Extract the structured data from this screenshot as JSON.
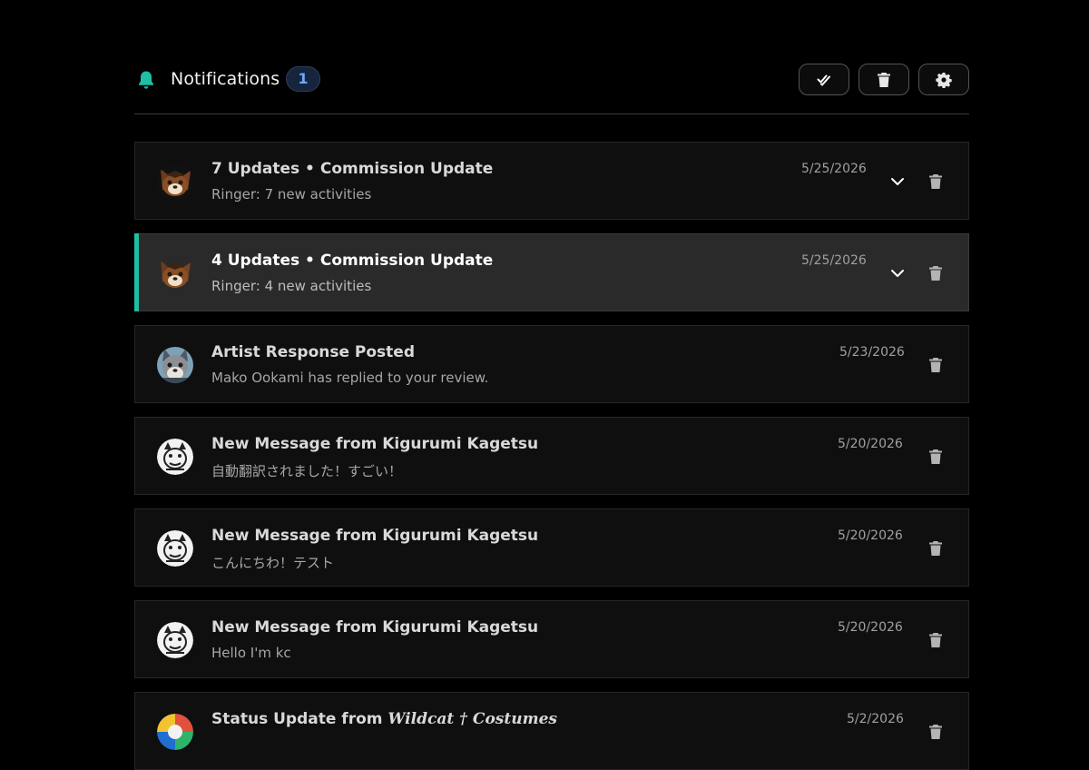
{
  "header": {
    "title": "Notifications",
    "unread_count": "1",
    "actions": [
      {
        "name": "mark-all-read",
        "icon": "double-check-icon"
      },
      {
        "name": "clear-all",
        "icon": "trash-icon"
      },
      {
        "name": "settings",
        "icon": "gear-icon"
      }
    ]
  },
  "colors": {
    "accent": "#1fbfa3",
    "badge_text": "#6ea8ff",
    "background": "#000000"
  },
  "notifications": [
    {
      "title": "7 Updates • Commission Update",
      "subtitle": "Ringer: 7 new activities",
      "date": "5/25/2026",
      "expandable": true,
      "active": false,
      "avatar_icon": "fox-character-avatar"
    },
    {
      "title": "4 Updates • Commission Update",
      "subtitle": "Ringer: 4 new activities",
      "date": "5/25/2026",
      "expandable": true,
      "active": true,
      "avatar_icon": "fox-character-avatar"
    },
    {
      "title": "Artist Response Posted",
      "subtitle": "Mako Ookami has replied to your review.",
      "date": "5/23/2026",
      "expandable": false,
      "active": false,
      "avatar_icon": "wolf-character-avatar"
    },
    {
      "title": "New Message from Kigurumi Kagetsu",
      "subtitle": "自動翻訳されました！すごい！",
      "date": "5/20/2026",
      "expandable": false,
      "active": false,
      "avatar_icon": "kagetsu-logo-avatar"
    },
    {
      "title": "New Message from Kigurumi Kagetsu",
      "subtitle": "こんにちわ！テスト",
      "date": "5/20/2026",
      "expandable": false,
      "active": false,
      "avatar_icon": "kagetsu-logo-avatar"
    },
    {
      "title": "New Message from Kigurumi Kagetsu",
      "subtitle": "Hello I'm kc",
      "date": "5/20/2026",
      "expandable": false,
      "active": false,
      "avatar_icon": "kagetsu-logo-avatar"
    },
    {
      "title_prefix": "Status Update from ",
      "title_brand": "Wildcat † Costumes",
      "subtitle": "",
      "date": "5/2/2026",
      "expandable": false,
      "active": false,
      "avatar_icon": "wildcat-logo-avatar"
    }
  ]
}
